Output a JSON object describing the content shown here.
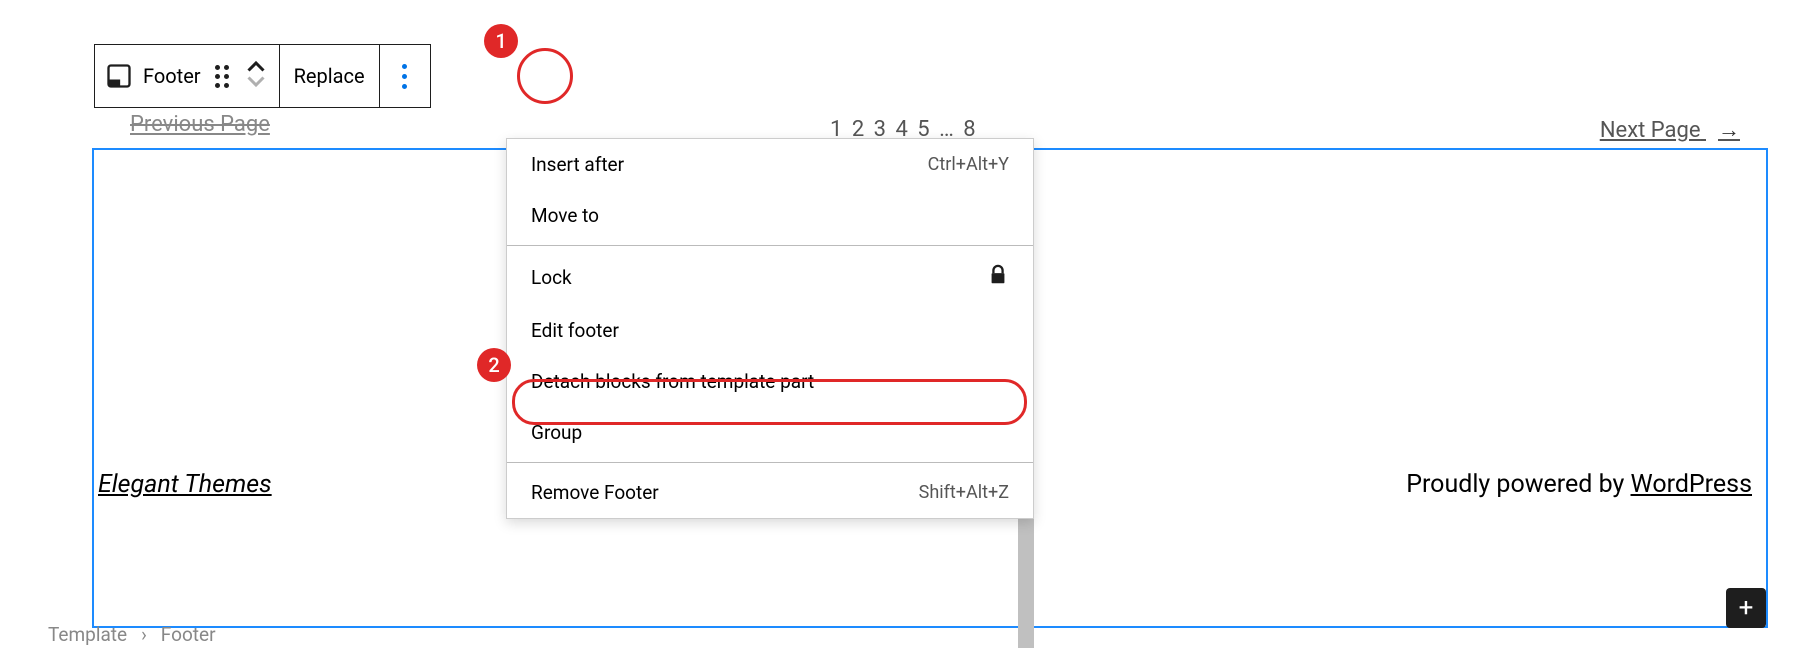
{
  "toolbar": {
    "block_label": "Footer",
    "replace_label": "Replace"
  },
  "annotations": {
    "n1": "1",
    "n2": "2"
  },
  "dropdown": {
    "insert_after": {
      "label": "Insert after",
      "shortcut": "Ctrl+Alt+Y"
    },
    "move_to": {
      "label": "Move to"
    },
    "lock": {
      "label": "Lock"
    },
    "edit_footer": {
      "label": "Edit footer"
    },
    "detach": {
      "label": "Detach blocks from template part"
    },
    "group": {
      "label": "Group"
    },
    "remove_footer": {
      "label": "Remove Footer",
      "shortcut": "Shift+Alt+Z"
    }
  },
  "page": {
    "prev": "Previous Page",
    "pagination": "1 2 3 4 5 … 8",
    "next": "Next Page",
    "next_arrow": "→",
    "footer_left": "Elegant Themes",
    "footer_right_prefix": "Proudly powered by ",
    "footer_right_link": "WordPress"
  },
  "breadcrumb": {
    "a": "Template",
    "sep": "›",
    "b": "Footer"
  }
}
